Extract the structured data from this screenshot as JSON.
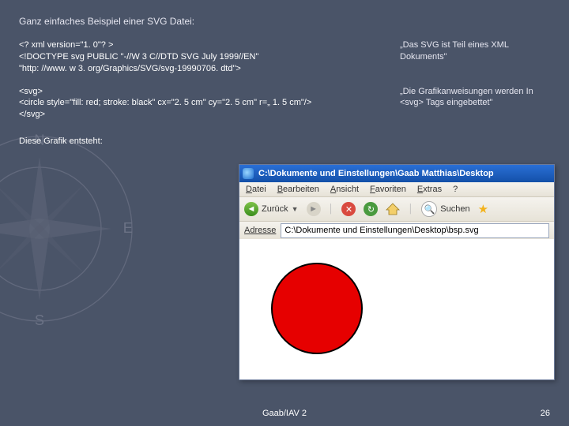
{
  "heading": "Ganz einfaches Beispiel einer SVG Datei:",
  "code1_l1": "<? xml version=\"1. 0\"? >",
  "code1_l2": "<!DOCTYPE svg PUBLIC \"-//W 3 C//DTD SVG July 1999//EN\"",
  "code1_l3": "\"http: //www. w 3. org/Graphics/SVG/svg-19990706. dtd\">",
  "anno1": "„Das SVG ist Teil eines XML Dokuments\"",
  "code2_l1": "<svg>",
  "code2_l2": "<circle style=\"fill: red; stroke: black\" cx=\"2. 5 cm\" cy=\"2. 5 cm\" r=„ 1. 5 cm\"/>",
  "code2_l3": "</svg>",
  "anno2": "„Die Grafikanweisungen werden In <svg> Tags eingebettet\"",
  "result_label": "Diese Grafik entsteht:",
  "ie": {
    "title": "C:\\Dokumente und Einstellungen\\Gaab Matthias\\Desktop",
    "menu": {
      "datei": "Datei",
      "bearbeiten": "Bearbeiten",
      "ansicht": "Ansicht",
      "favoriten": "Favoriten",
      "extras": "Extras",
      "help": "?"
    },
    "toolbar": {
      "back": "Zurück",
      "search": "Suchen"
    },
    "addrlabel": "Adresse",
    "addrvalue": "C:\\Dokumente und Einstellungen\\Desktop\\bsp.svg"
  },
  "footer": "Gaab/IAV 2",
  "pagenum": "26"
}
